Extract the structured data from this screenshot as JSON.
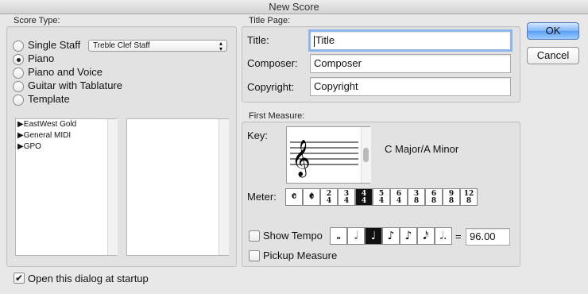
{
  "window": {
    "title": "New Score"
  },
  "score_type": {
    "group_label": "Score Type:",
    "options": [
      {
        "label": "Single Staff",
        "selected": false
      },
      {
        "label": "Piano",
        "selected": true
      },
      {
        "label": "Piano and Voice",
        "selected": false
      },
      {
        "label": "Guitar with Tablature",
        "selected": false
      },
      {
        "label": "Template",
        "selected": false
      }
    ],
    "staff_select": {
      "value": "Treble Clef Staff"
    },
    "template_list": [
      "EastWest Gold",
      "General MIDI",
      "GPO"
    ]
  },
  "title_page": {
    "group_label": "Title Page:",
    "title": {
      "label": "Title:",
      "value": "Title"
    },
    "composer": {
      "label": "Composer:",
      "value": "Composer"
    },
    "copyright": {
      "label": "Copyright:",
      "value": "Copyright"
    }
  },
  "first_measure": {
    "group_label": "First Measure:",
    "key_label": "Key:",
    "key_value": "C Major/A Minor",
    "meter_label": "Meter:",
    "meters": [
      {
        "top": "𝄴",
        "bottom": ""
      },
      {
        "top": "𝄵",
        "bottom": ""
      },
      {
        "top": "2",
        "bottom": "4"
      },
      {
        "top": "3",
        "bottom": "4"
      },
      {
        "top": "4",
        "bottom": "4"
      },
      {
        "top": "5",
        "bottom": "4"
      },
      {
        "top": "6",
        "bottom": "4"
      },
      {
        "top": "3",
        "bottom": "8"
      },
      {
        "top": "6",
        "bottom": "8"
      },
      {
        "top": "9",
        "bottom": "8"
      },
      {
        "top": "12",
        "bottom": "8"
      }
    ],
    "selected_meter_index": 4,
    "show_tempo": {
      "label": "Show Tempo",
      "checked": false
    },
    "tempo_notes": [
      "𝅝",
      "𝅗𝅥",
      "♩",
      "♪",
      "♪",
      "𝅘𝅥𝅯",
      "𝅗𝅥."
    ],
    "selected_tempo_index": 2,
    "tempo_equals": "=",
    "tempo_value": "96.00",
    "pickup_measure": {
      "label": "Pickup Measure",
      "checked": false
    }
  },
  "buttons": {
    "ok": "OK",
    "cancel": "Cancel"
  },
  "startup": {
    "label": "Open this dialog at startup",
    "checked": true
  }
}
